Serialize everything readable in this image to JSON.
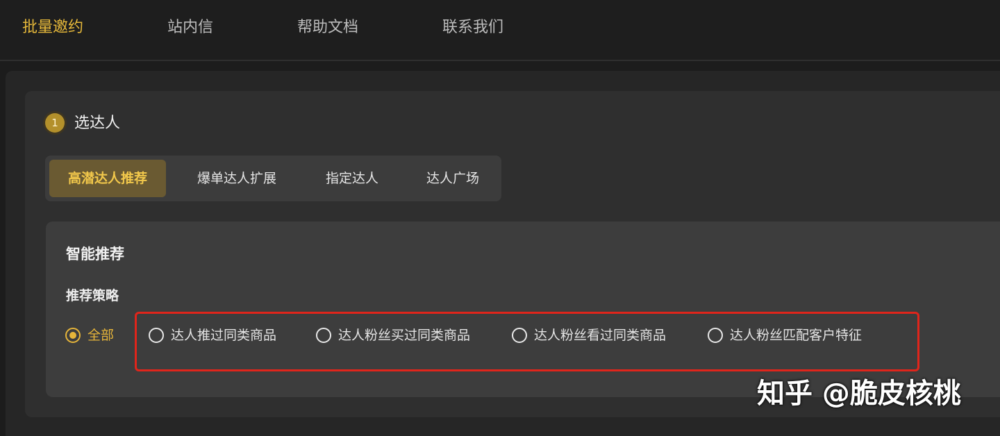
{
  "topnav": {
    "items": [
      {
        "label": "批量邀约",
        "active": true
      },
      {
        "label": "站内信"
      },
      {
        "label": "帮助文档"
      },
      {
        "label": "联系我们"
      }
    ]
  },
  "step": {
    "number": "1",
    "title": "选达人"
  },
  "tabs": [
    {
      "label": "高潜达人推荐",
      "active": true
    },
    {
      "label": "爆单达人扩展"
    },
    {
      "label": "指定达人"
    },
    {
      "label": "达人广场"
    }
  ],
  "section": {
    "title": "智能推荐",
    "strategy_label": "推荐策略",
    "options": [
      {
        "label": "全部",
        "selected": true
      },
      {
        "label": "达人推过同类商品"
      },
      {
        "label": "达人粉丝买过同类商品"
      },
      {
        "label": "达人粉丝看过同类商品"
      },
      {
        "label": "达人粉丝匹配客户特征"
      }
    ]
  },
  "watermark": "知乎 @脆皮核桃",
  "colors": {
    "accent": "#e6b53a",
    "highlight_border": "#e0251b",
    "background": "#1c1c1c"
  }
}
